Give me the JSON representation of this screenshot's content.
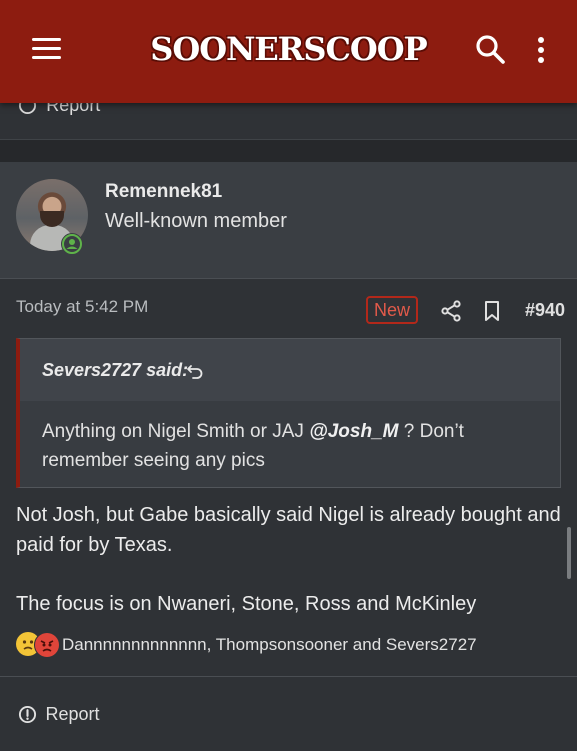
{
  "header": {
    "logo_text": "SOONERSCOOP",
    "background_color": "#8d1c10",
    "menu_icon": "hamburger-icon",
    "search_icon": "search-icon",
    "more_icon": "vertical-ellipsis-icon"
  },
  "previous_post": {
    "report_label": "Report"
  },
  "post": {
    "username": "Remennek81",
    "user_title": "Well-known member",
    "online_status_icon": "online-status-icon",
    "timestamp": "Today at 5:42 PM",
    "new_badge": "New",
    "post_number": "#940",
    "quote": {
      "author": "Severs2727 said:",
      "text_before": "Anything on Nigel Smith or JAJ ",
      "mention": "@Josh_M",
      "text_after": " ? Don’t remember seeing any pics"
    },
    "body": [
      "Not Josh, but Gabe basically said Nigel is already bought and paid for by Texas.",
      "The focus is on Nwaneri, Stone, Ross and McKinley"
    ],
    "reactions": {
      "emojis": [
        "confused-face-icon",
        "angry-face-icon"
      ],
      "names": "Dannnnnnnnnnnnn, Thompsonsooner and Severs2727"
    },
    "report_label": "Report"
  }
}
